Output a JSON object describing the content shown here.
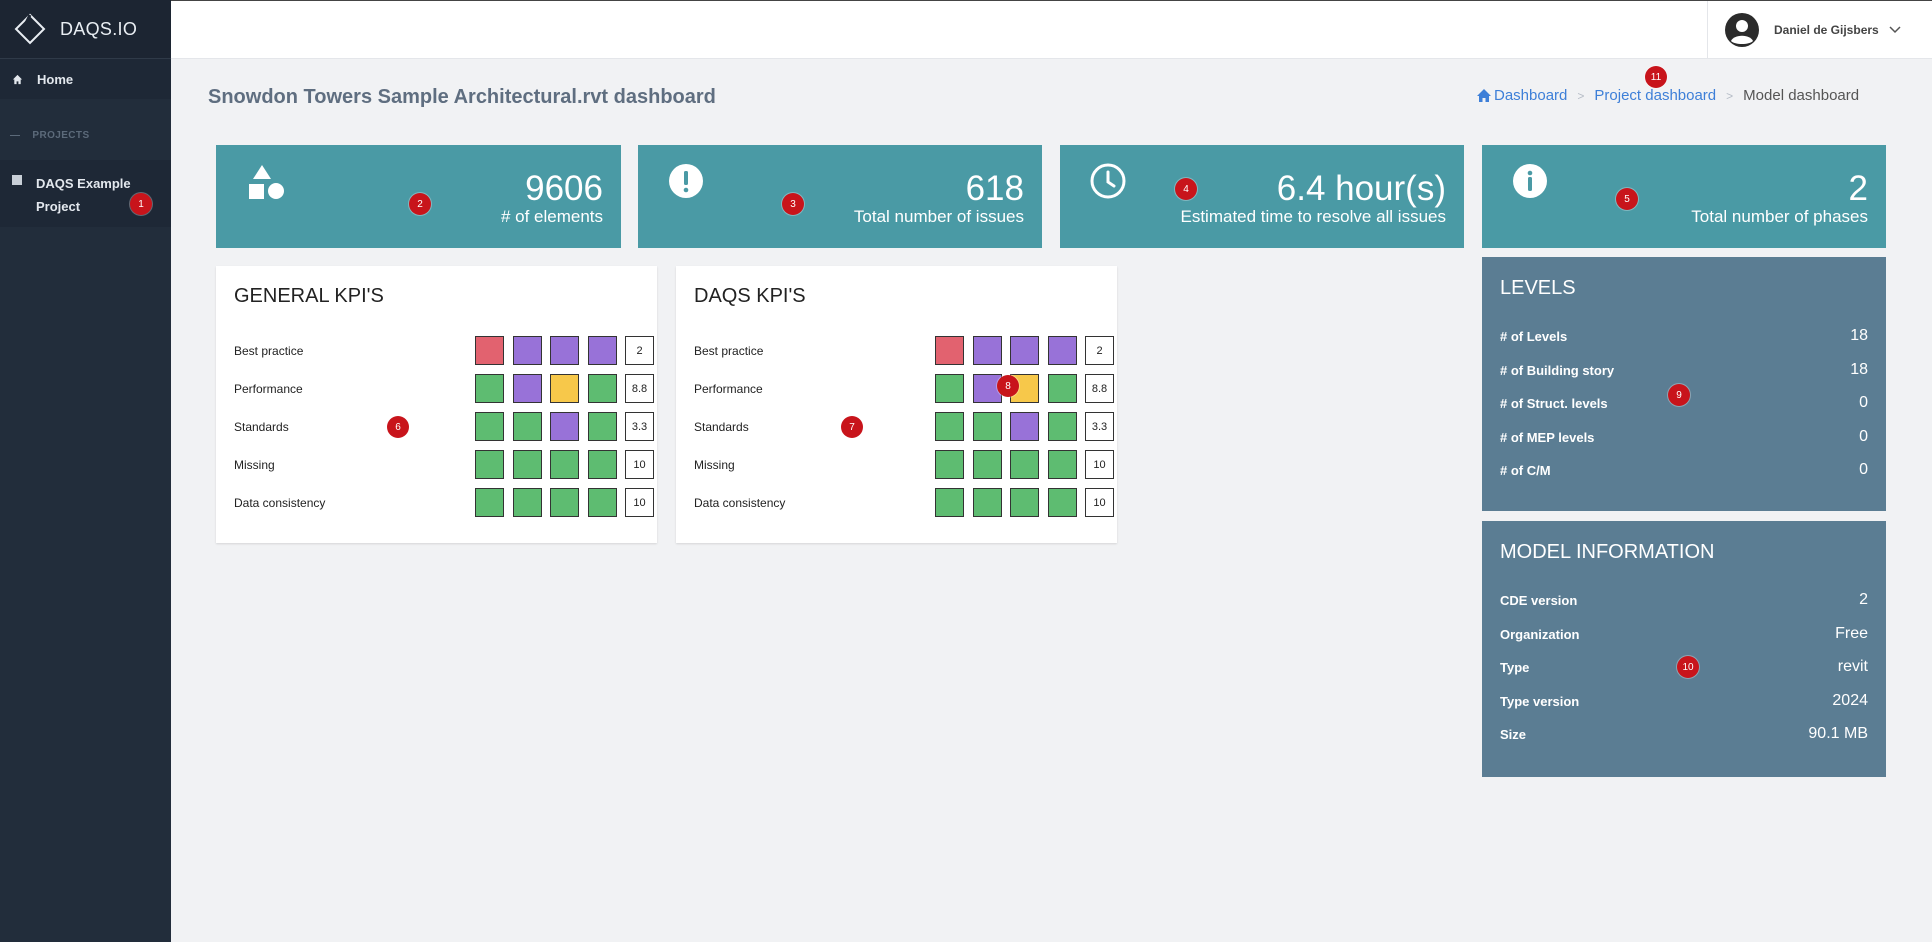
{
  "brand": {
    "name": "DAQS.IO"
  },
  "sidebar": {
    "home_label": "Home",
    "section_label": "PROJECTS",
    "project_label": "DAQS Example Project"
  },
  "user": {
    "name": "Daniel de Gijsbers"
  },
  "page": {
    "title": "Snowdon Towers Sample Architectural.rvt dashboard"
  },
  "breadcrumb": {
    "items": [
      "Dashboard",
      "Project dashboard",
      "Model dashboard"
    ]
  },
  "stats": [
    {
      "value": "9606",
      "label": "# of elements",
      "icon": "shapes-icon"
    },
    {
      "value": "618",
      "label": "Total number of issues",
      "icon": "alert-icon"
    },
    {
      "value": "6.4 hour(s)",
      "label": "Estimated time to resolve all issues",
      "icon": "clock-icon"
    },
    {
      "value": "2",
      "label": "Total number of phases",
      "icon": "info-icon"
    }
  ],
  "kpi_cards": [
    {
      "title": "GENERAL KPI'S",
      "rows": [
        {
          "label": "Best practice",
          "cells": [
            "red",
            "purple",
            "purple",
            "purple"
          ],
          "score": "2"
        },
        {
          "label": "Performance",
          "cells": [
            "green",
            "purple",
            "yellow",
            "green"
          ],
          "score": "8.8"
        },
        {
          "label": "Standards",
          "cells": [
            "green",
            "green",
            "purple",
            "green"
          ],
          "score": "3.3"
        },
        {
          "label": "Missing",
          "cells": [
            "green",
            "green",
            "green",
            "green"
          ],
          "score": "10"
        },
        {
          "label": "Data consistency",
          "cells": [
            "green",
            "green",
            "green",
            "green"
          ],
          "score": "10"
        }
      ]
    },
    {
      "title": "DAQS KPI'S",
      "rows": [
        {
          "label": "Best practice",
          "cells": [
            "red",
            "purple",
            "purple",
            "purple"
          ],
          "score": "2"
        },
        {
          "label": "Performance",
          "cells": [
            "green",
            "purple",
            "yellow",
            "green"
          ],
          "score": "8.8"
        },
        {
          "label": "Standards",
          "cells": [
            "green",
            "green",
            "purple",
            "green"
          ],
          "score": "3.3"
        },
        {
          "label": "Missing",
          "cells": [
            "green",
            "green",
            "green",
            "green"
          ],
          "score": "10"
        },
        {
          "label": "Data consistency",
          "cells": [
            "green",
            "green",
            "green",
            "green"
          ],
          "score": "10"
        }
      ]
    }
  ],
  "levels": {
    "title": "LEVELS",
    "rows": [
      {
        "label": "# of Levels",
        "value": "18"
      },
      {
        "label": "# of Building story",
        "value": "18"
      },
      {
        "label": "# of Struct. levels",
        "value": "0"
      },
      {
        "label": "# of MEP levels",
        "value": "0"
      },
      {
        "label": "# of C/M",
        "value": "0"
      }
    ]
  },
  "model_info": {
    "title": "MODEL INFORMATION",
    "rows": [
      {
        "label": "CDE version",
        "value": "2"
      },
      {
        "label": "Organization",
        "value": "Free"
      },
      {
        "label": "Type",
        "value": "revit"
      },
      {
        "label": "Type version",
        "value": "2024"
      },
      {
        "label": "Size",
        "value": "90.1 MB"
      }
    ]
  },
  "markers": [
    "1",
    "2",
    "3",
    "4",
    "5",
    "6",
    "7",
    "8",
    "9",
    "10",
    "11"
  ],
  "colors": {
    "sidebar": "#222d3b",
    "stat_card": "#4a9aa5",
    "panel": "#5b7d93",
    "kpi_red": "#e2626f",
    "kpi_purple": "#9872d8",
    "kpi_green": "#5ebc71",
    "kpi_yellow": "#f7c84a",
    "link": "#3d7fd8",
    "marker": "#c8141b"
  }
}
